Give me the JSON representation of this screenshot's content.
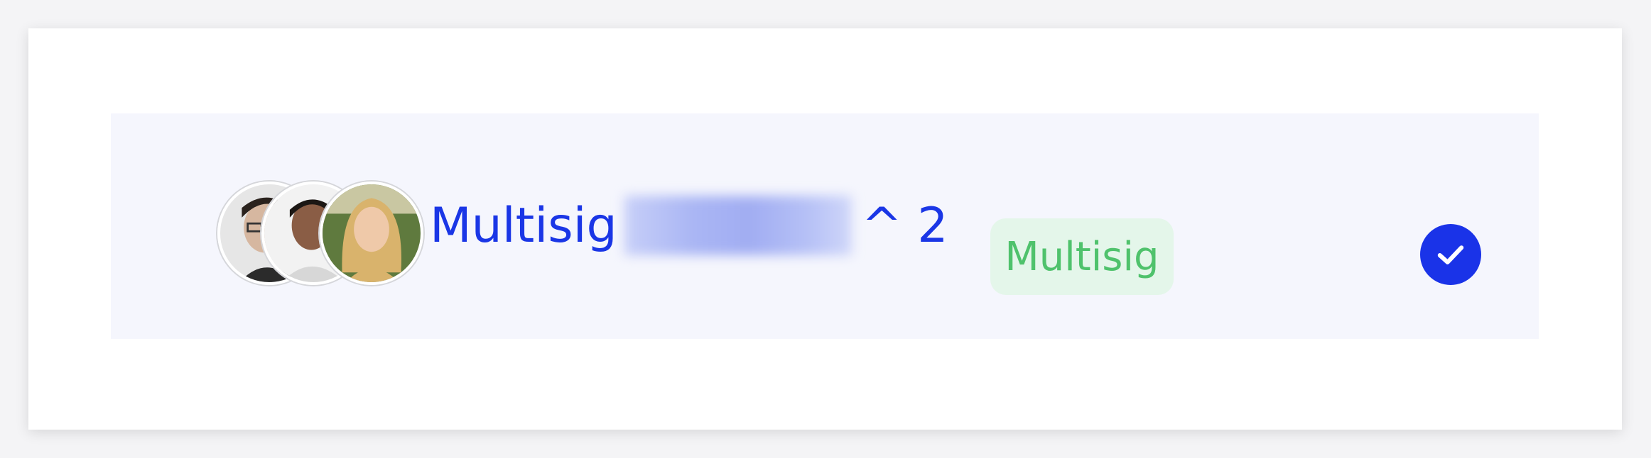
{
  "wallet": {
    "name_prefix": "Multisig",
    "name_suffix": "^ 2",
    "badge": "Multisig",
    "selected": true
  },
  "icons": {
    "avatars": [
      "avatar-man-glasses",
      "avatar-man-dark-hair",
      "avatar-woman-blonde"
    ],
    "check": "check-circle-icon"
  },
  "colors": {
    "primary": "#1a36e6",
    "badge_bg": "#e4f6ea",
    "badge_text": "#4fc26c",
    "row_bg": "#f5f6fd"
  }
}
